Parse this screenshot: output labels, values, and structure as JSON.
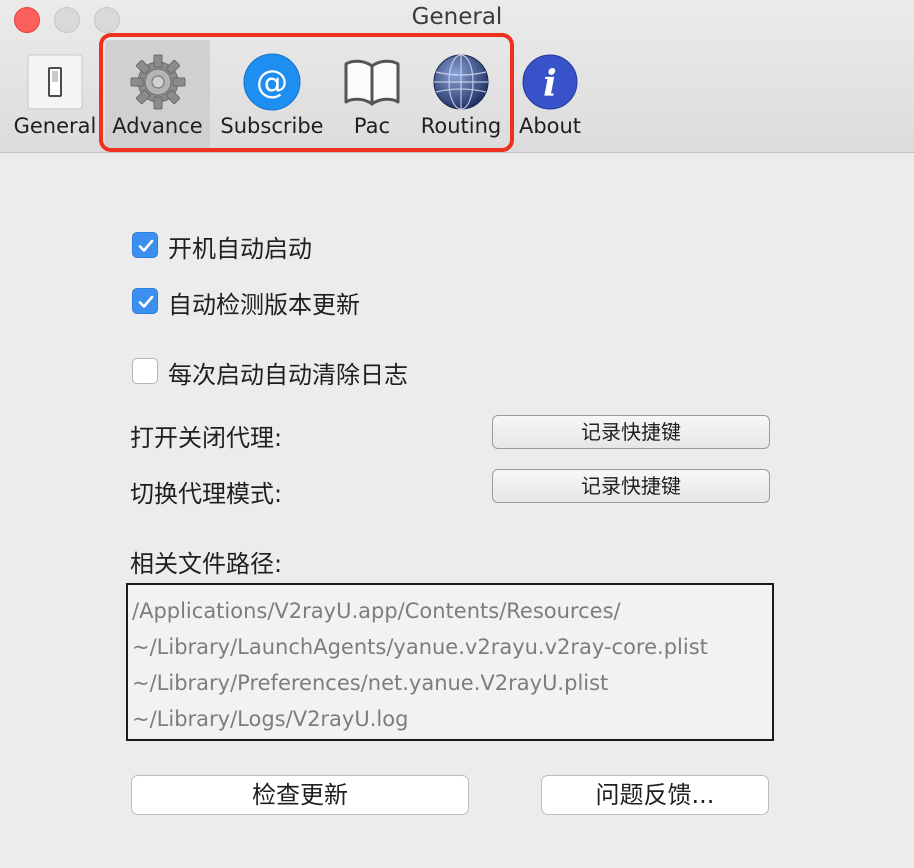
{
  "window": {
    "title": "General"
  },
  "toolbar": {
    "items": [
      {
        "key": "general",
        "label": "General",
        "icon": "switch-icon"
      },
      {
        "key": "advance",
        "label": "Advance",
        "icon": "gear-icon",
        "selected": true
      },
      {
        "key": "subscribe",
        "label": "Subscribe",
        "icon": "at-sign-icon"
      },
      {
        "key": "pac",
        "label": "Pac",
        "icon": "book-icon"
      },
      {
        "key": "routing",
        "label": "Routing",
        "icon": "globe-icon"
      },
      {
        "key": "about",
        "label": "About",
        "icon": "info-icon"
      }
    ]
  },
  "options": {
    "launch_at_login": {
      "label": "开机自动启动",
      "checked": true
    },
    "auto_check_version": {
      "label": "自动检测版本更新",
      "checked": true
    },
    "clear_log_on_launch": {
      "label": "每次启动自动清除日志",
      "checked": false
    }
  },
  "shortcuts": {
    "toggle_proxy": {
      "label": "打开关闭代理:",
      "button": "记录快捷键"
    },
    "switch_mode": {
      "label": "切换代理模式:",
      "button": "记录快捷键"
    }
  },
  "files": {
    "label": "相关文件路径:",
    "paths": [
      "/Applications/V2rayU.app/Contents/Resources/",
      "~/Library/LaunchAgents/yanue.v2rayu.v2ray-core.plist",
      "~/Library/Preferences/net.yanue.V2rayU.plist",
      "~/Library/Logs/V2rayU.log"
    ]
  },
  "actions": {
    "check_update": "检查更新",
    "feedback": "问题反馈..."
  },
  "colors": {
    "accent": "#3d8fef",
    "highlight_border": "#f0301f",
    "close": "#fc605c"
  }
}
